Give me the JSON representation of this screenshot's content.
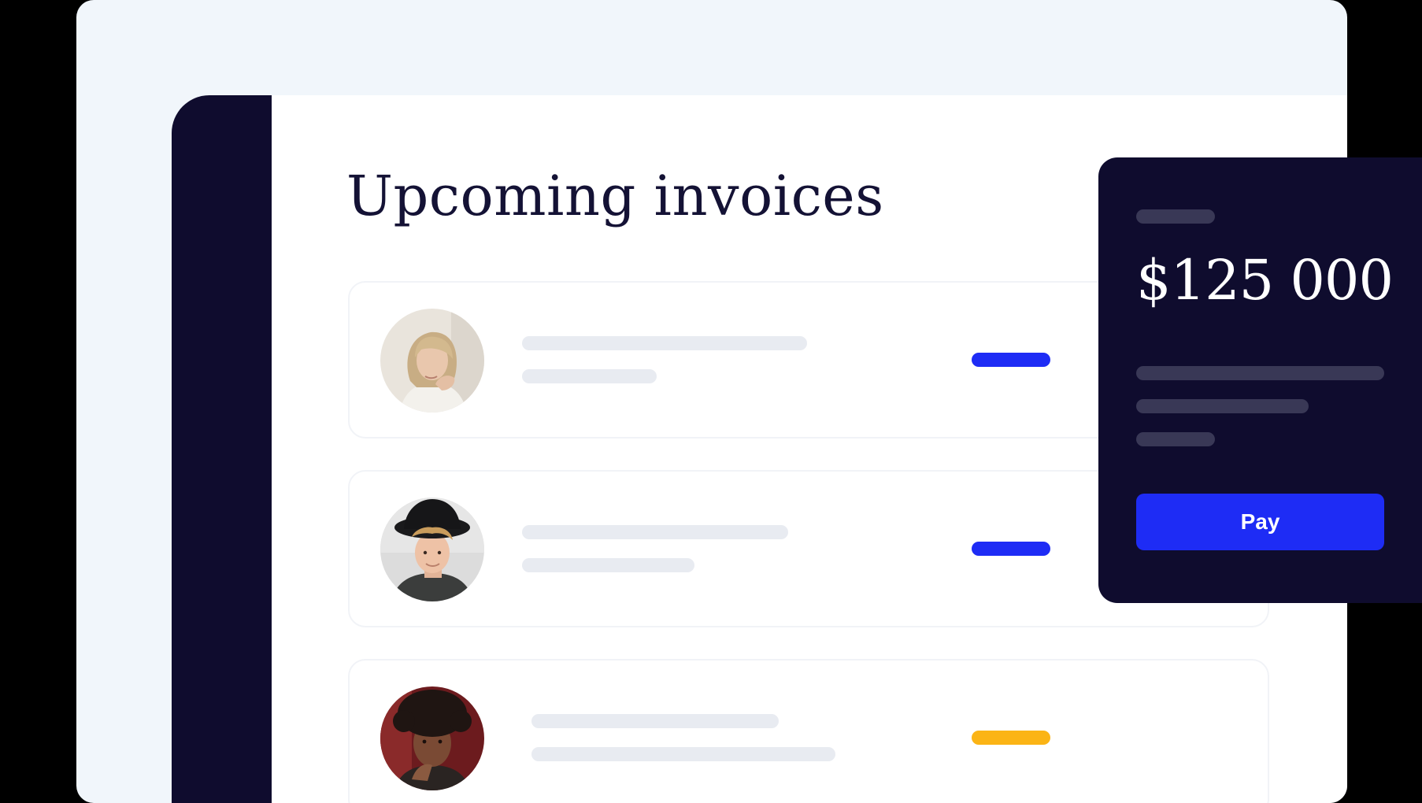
{
  "main": {
    "title": "Upcoming invoices"
  },
  "invoices": [
    {
      "avatar": "avatar-woman-blonde",
      "status_color": "#1e2cf5"
    },
    {
      "avatar": "avatar-man-hat",
      "status_color": "#1e2cf5"
    },
    {
      "avatar": "avatar-man-curly-hair",
      "status_color": "#fbb415"
    }
  ],
  "payment_card": {
    "amount": "$125 000",
    "pay_label": "Pay",
    "button_color": "#1e2cf5"
  },
  "colors": {
    "sidebar": "#0f0c2e",
    "title": "#141235",
    "background": "#f1f6fb",
    "skeleton": "#e8ebf1"
  }
}
